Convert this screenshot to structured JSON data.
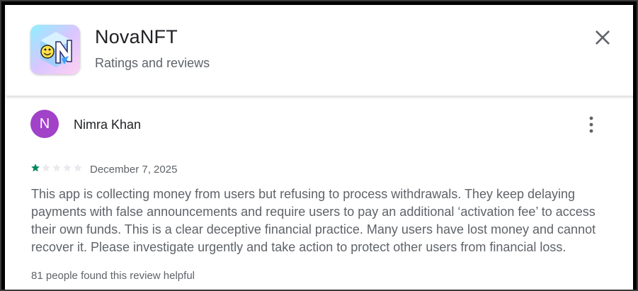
{
  "app": {
    "title": "NovaNFT",
    "subtitle": "Ratings and reviews",
    "icon": "novanft-logo-icon"
  },
  "close": {
    "icon": "close-icon"
  },
  "review": {
    "avatar_initial": "N",
    "avatar_color": "#a142c8",
    "reviewer_name": "Nimra Khan",
    "more_icon": "more-vert-icon",
    "rating": 1,
    "rating_max": 5,
    "star_filled_color": "#01875f",
    "star_empty_color": "#e8eaed",
    "date": "December 7, 2025",
    "text": "This app is collecting money from users but refusing to process withdrawals. They keep delaying payments with false announcements and require users to pay an additional ‘activation fee’ to access their own funds. This is a clear deceptive financial practice. Many users have lost money and cannot recover it. Please investigate urgently and take action to protect other users from financial loss.",
    "helpful_text": "81 people found this review helpful"
  }
}
